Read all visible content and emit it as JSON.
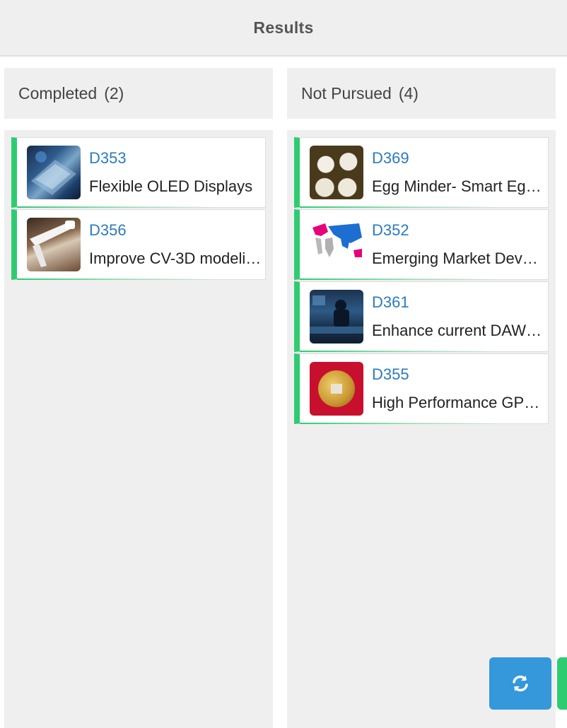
{
  "header": {
    "title": "Results"
  },
  "columns": [
    {
      "label": "Completed",
      "count": "(2)",
      "cards": [
        {
          "id": "D353",
          "title": "Flexible OLED Displays",
          "thumbnail": "oled-photo"
        },
        {
          "id": "D356",
          "title": "Improve CV-3D modeli…",
          "thumbnail": "robot-arm-photo"
        }
      ]
    },
    {
      "label": "Not Pursued",
      "count": "(4)",
      "cards": [
        {
          "id": "D369",
          "title": "Egg Minder- Smart Eg…",
          "thumbnail": "eggs-photo"
        },
        {
          "id": "D352",
          "title": "Emerging Market Dev…",
          "thumbnail": "world-map"
        },
        {
          "id": "D361",
          "title": "Enhance current DAW…",
          "thumbnail": "studio-photo"
        },
        {
          "id": "D355",
          "title": "High Performance GP…",
          "thumbnail": "chip-photo"
        }
      ]
    }
  ],
  "actions": {
    "refresh_icon": "refresh-icon"
  },
  "colors": {
    "accent_green": "#2ecc71",
    "link_blue": "#2b7bbd",
    "button_blue": "#3498db"
  }
}
